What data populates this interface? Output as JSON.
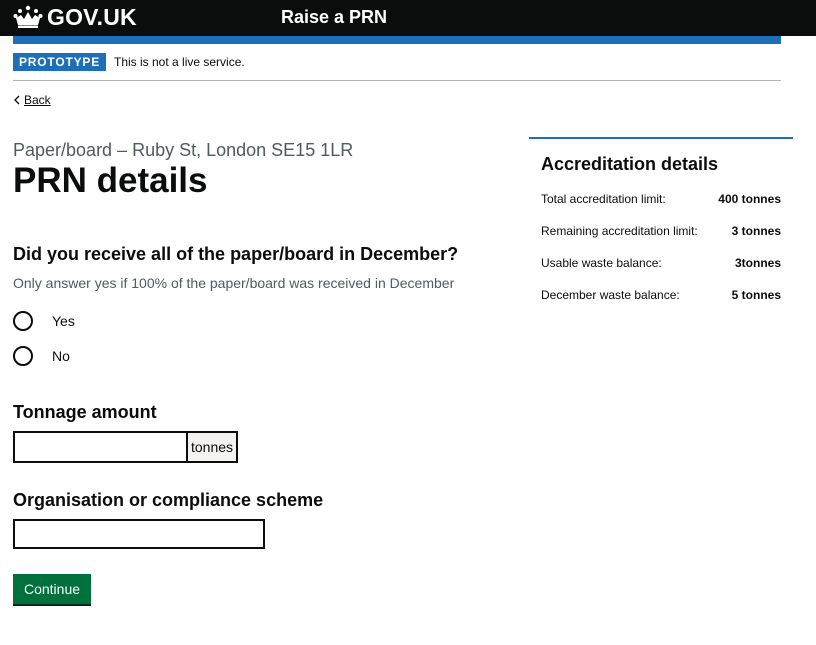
{
  "header": {
    "logo_text": "GOV.UK",
    "service_name": "Raise a PRN"
  },
  "phase_banner": {
    "tag": "PROTOTYPE",
    "text": "This is not a live service."
  },
  "back_link": "Back",
  "caption": "Paper/board – Ruby St, London SE15 1LR",
  "title": "PRN details",
  "question": {
    "legend": "Did you receive all of the paper/board in December?",
    "hint": "Only answer yes if 100% of the paper/board was received in December",
    "options": [
      "Yes",
      "No"
    ]
  },
  "tonnage": {
    "label": "Tonnage amount",
    "value": "",
    "suffix": "tonnes"
  },
  "organisation": {
    "label": "Organisation or compliance scheme",
    "value": ""
  },
  "continue_button": "Continue",
  "accreditation": {
    "title": "Accreditation details",
    "rows": [
      {
        "label": "Total accreditation limit:",
        "value": "400 tonnes"
      },
      {
        "label": "Remaining accreditation limit:",
        "value": "3 tonnes"
      },
      {
        "label": "Usable waste balance:",
        "value": "3tonnes"
      },
      {
        "label": "December waste balance:",
        "value": "5 tonnes"
      }
    ]
  },
  "colors": {
    "header_bg": "#0b0c0c",
    "brand_blue": "#1d70b8",
    "button_green": "#00703c",
    "secondary_text": "#505a5f"
  }
}
